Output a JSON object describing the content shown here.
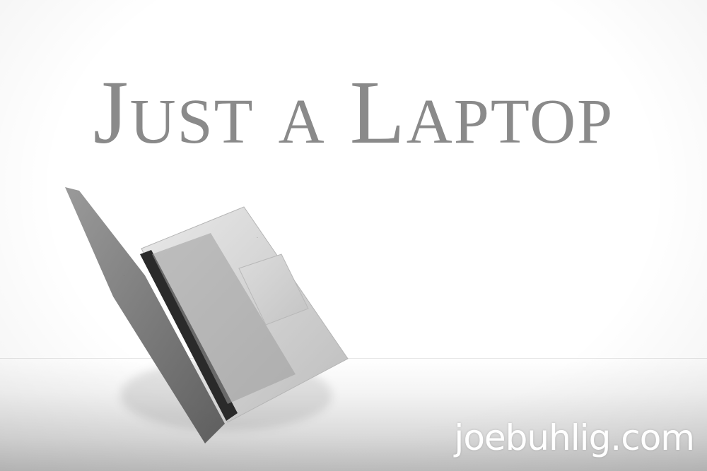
{
  "photo": {
    "title": "Just a Laptop",
    "watermark": "joebuhlig.com",
    "subject_icon": "laptop-icon",
    "colors": {
      "background": "#ffffff",
      "title": "#8a8a8a",
      "watermark": "#ffffff",
      "aluminum": "#cfcfcf",
      "keys": "#141414"
    }
  }
}
